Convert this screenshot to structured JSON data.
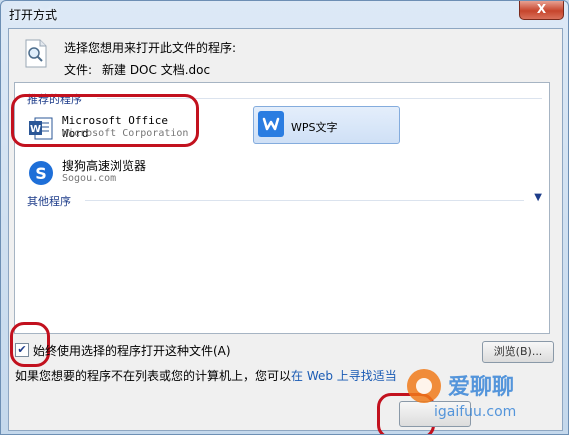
{
  "window": {
    "title": "打开方式",
    "close_glyph": "X"
  },
  "header": {
    "prompt": "选择您想用来打开此文件的程序:",
    "file_label": "文件:",
    "file_name": "新建 DOC 文档.doc"
  },
  "recommended": {
    "heading": "推荐的程序",
    "programs": [
      {
        "name": "Microsoft Office Word",
        "maker": "Microsoft Corporation",
        "icon": "word-icon"
      },
      {
        "name": "WPS文字",
        "maker": "",
        "icon": "wps-icon"
      },
      {
        "name": "搜狗高速浏览器",
        "maker": "Sogou.com",
        "icon": "sogou-icon"
      }
    ]
  },
  "other": {
    "heading": "其他程序",
    "expand_icon": "chevron-down-icon"
  },
  "always_use": {
    "label": "始终使用选择的程序打开这种文件(A)",
    "checked": true
  },
  "buttons": {
    "browse": "浏览(B)..."
  },
  "footer": {
    "text_before": "如果您想要的程序不在列表或您的计算机上，您可以",
    "link": "在 Web 上寻找适当"
  },
  "watermark": {
    "text": "爱聊聊",
    "url": "igaifuu.com"
  },
  "colors": {
    "highlight": "#c2111e",
    "accent": "#1e3d8a",
    "wps_blue": "#2b7de1",
    "word_blue": "#2b5797"
  }
}
